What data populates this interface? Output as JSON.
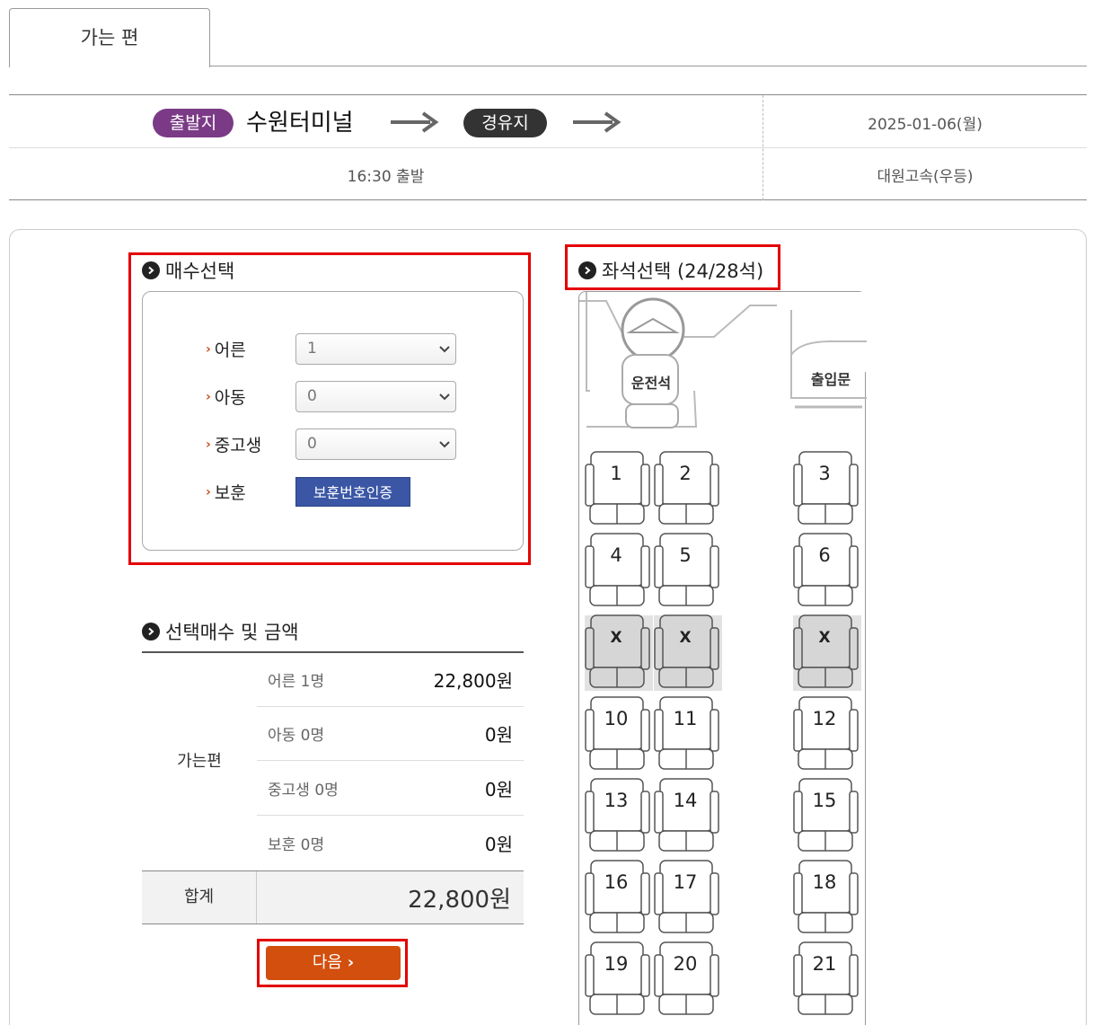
{
  "tab": {
    "label": "가는 편"
  },
  "route": {
    "depart_badge": "출발지",
    "terminal": "수원터미널",
    "via_badge": "경유지",
    "date": "2025-01-06(월)",
    "time": "16:30 출발",
    "company": "대원고속(우등)"
  },
  "count_section": {
    "title": "매수선택",
    "rows": [
      {
        "label": "어른",
        "value": "1"
      },
      {
        "label": "아동",
        "value": "0"
      },
      {
        "label": "중고생",
        "value": "0"
      }
    ],
    "veteran_label": "보훈",
    "veteran_button": "보훈번호인증"
  },
  "price_section": {
    "title": "선택매수 및 금액",
    "group_label": "가는편",
    "rows": [
      {
        "label": "어른 1명",
        "value": "22,800원"
      },
      {
        "label": "아동 0명",
        "value": "0원"
      },
      {
        "label": "중고생 0명",
        "value": "0원"
      },
      {
        "label": "보훈 0명",
        "value": "0원"
      }
    ],
    "total_label": "합계",
    "total_value": "22,800원"
  },
  "next_button": "다음",
  "seat_section": {
    "title": "좌석선택 (24/28석)",
    "driver_label": "운전석",
    "door_label": "출입문",
    "seats": [
      {
        "label": "1",
        "taken": false
      },
      {
        "label": "2",
        "taken": false
      },
      {
        "label": "3",
        "taken": false
      },
      {
        "label": "4",
        "taken": false
      },
      {
        "label": "5",
        "taken": false
      },
      {
        "label": "6",
        "taken": false
      },
      {
        "label": "X",
        "taken": true
      },
      {
        "label": "X",
        "taken": true
      },
      {
        "label": "X",
        "taken": true
      },
      {
        "label": "10",
        "taken": false
      },
      {
        "label": "11",
        "taken": false
      },
      {
        "label": "12",
        "taken": false
      },
      {
        "label": "13",
        "taken": false
      },
      {
        "label": "14",
        "taken": false
      },
      {
        "label": "15",
        "taken": false
      },
      {
        "label": "16",
        "taken": false
      },
      {
        "label": "17",
        "taken": false
      },
      {
        "label": "18",
        "taken": false
      },
      {
        "label": "19",
        "taken": false
      },
      {
        "label": "20",
        "taken": false
      },
      {
        "label": "21",
        "taken": false
      }
    ]
  },
  "colors": {
    "depart_pill": "#7b3a86",
    "via_pill": "#333333",
    "verify_button": "#3a56a5",
    "next_button": "#d24f0e",
    "highlight": "#e30000"
  }
}
